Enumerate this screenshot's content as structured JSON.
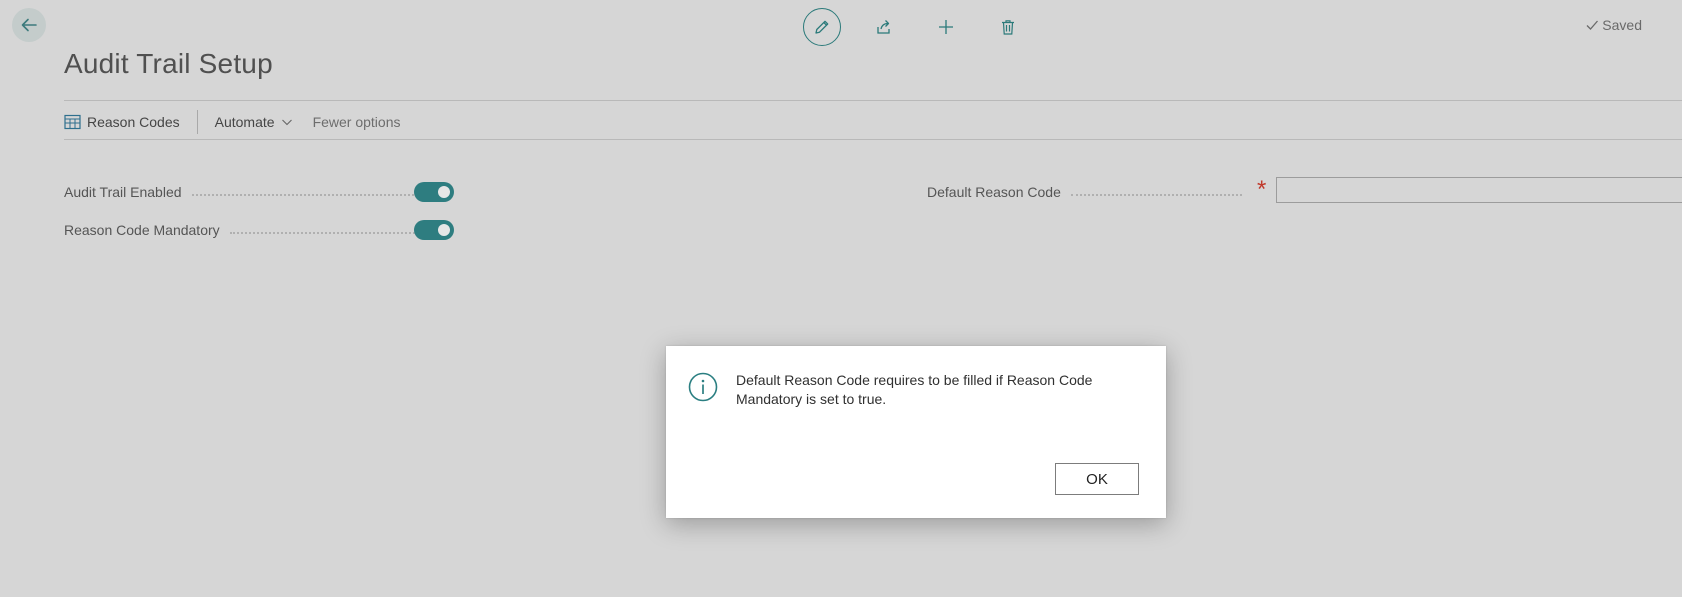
{
  "header": {
    "back_icon": "arrow-left-icon",
    "actions": [
      {
        "name": "edit",
        "icon": "pencil-icon"
      },
      {
        "name": "share",
        "icon": "share-icon"
      },
      {
        "name": "new",
        "icon": "plus-icon"
      },
      {
        "name": "delete",
        "icon": "trash-icon"
      }
    ],
    "status": "Saved",
    "status_icon": "check-icon"
  },
  "page": {
    "title": "Audit Trail Setup"
  },
  "toolbar": {
    "reason_codes_label": "Reason Codes",
    "reason_codes_icon": "table-icon",
    "automate_label": "Automate",
    "automate_icon": "chevron-down-icon",
    "fewer_options_label": "Fewer options"
  },
  "fields": {
    "audit_trail_enabled": {
      "label": "Audit Trail Enabled",
      "value": true
    },
    "reason_code_mandatory": {
      "label": "Reason Code Mandatory",
      "value": true
    },
    "default_reason_code": {
      "label": "Default Reason Code",
      "value": "",
      "required_marker": "*"
    }
  },
  "dialog": {
    "icon": "info-icon",
    "message": "Default Reason Code requires to be filled if Reason Code Mandatory is set to true.",
    "ok_label": "OK"
  },
  "colors": {
    "accent": "#2e7d80",
    "background": "#d6d6d6",
    "required": "#c0392b"
  }
}
